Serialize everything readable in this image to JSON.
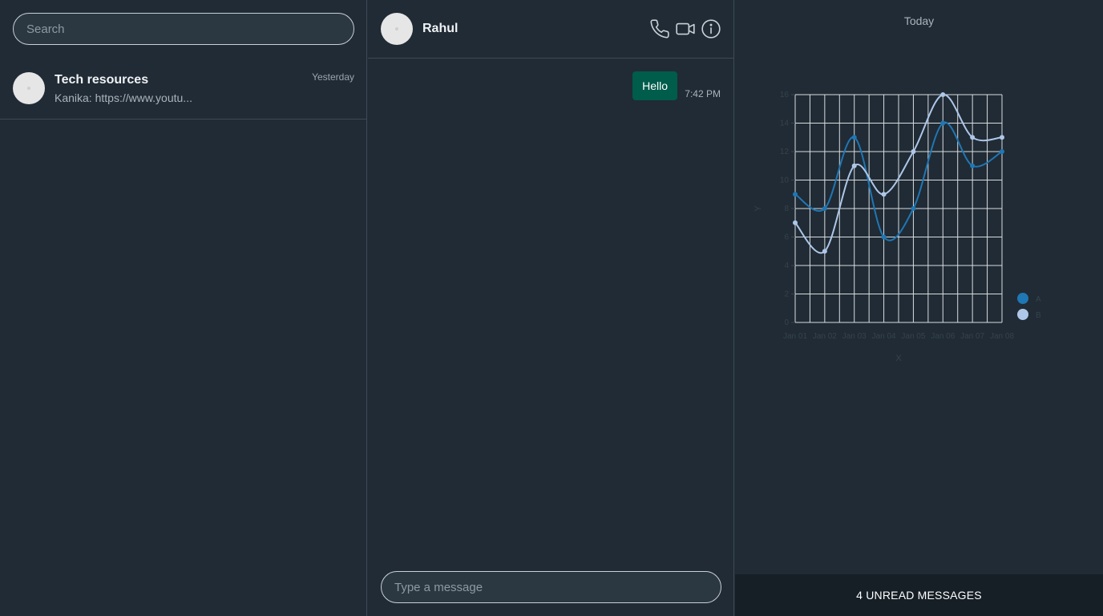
{
  "search": {
    "placeholder": "Search"
  },
  "chats": [
    {
      "name": "Tech resources",
      "preview": "Kanika: https://www.youtu...",
      "time": "Yesterday"
    }
  ],
  "conversation": {
    "contact_name": "Rahul",
    "messages": [
      {
        "text": "Hello",
        "time": "7:42 PM",
        "outgoing": true
      }
    ],
    "input_placeholder": "Type a message"
  },
  "header_icons": [
    "phone-icon",
    "video-camera-icon",
    "info-icon"
  ],
  "right_panel": {
    "day_label": "Today",
    "unread_label": "4 UNREAD MESSAGES"
  },
  "colors": {
    "background": "#202b35",
    "bubble_outgoing": "#005c4b",
    "series_a": "#1f77b4",
    "series_b": "#aec7e8"
  },
  "chart_data": {
    "type": "line",
    "title": "",
    "xlabel": "X",
    "ylabel": "Y",
    "x": [
      "Jan 01",
      "Jan 02",
      "Jan 03",
      "Jan 04",
      "Jan 05",
      "Jan 06",
      "Jan 07",
      "Jan 08"
    ],
    "ylim": [
      0,
      16
    ],
    "yticks": [
      0,
      2,
      4,
      6,
      8,
      10,
      12,
      14,
      16
    ],
    "grid": true,
    "legend_position": "right",
    "series": [
      {
        "name": "A",
        "color": "#1f77b4",
        "values": [
          9,
          8,
          13,
          6,
          8,
          14,
          11,
          12
        ]
      },
      {
        "name": "B",
        "color": "#aec7e8",
        "values": [
          7,
          5,
          11,
          9,
          12,
          16,
          13,
          13
        ]
      }
    ]
  }
}
